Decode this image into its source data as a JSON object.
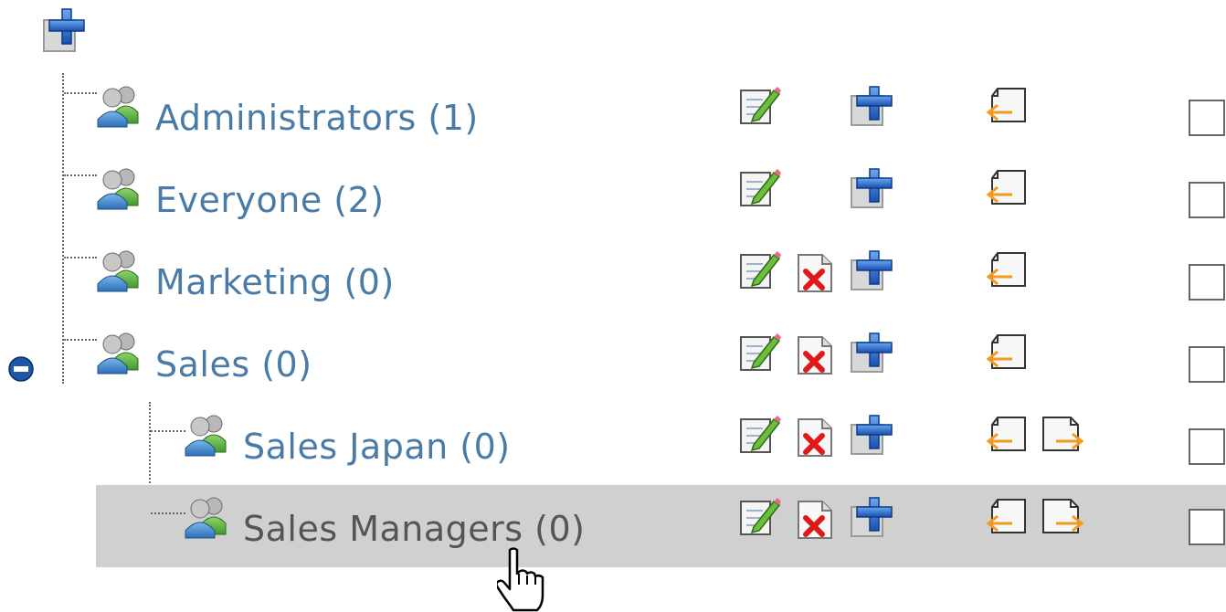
{
  "tree": {
    "groups": [
      {
        "label": "Administrators (1)"
      },
      {
        "label": "Everyone (2)"
      },
      {
        "label": "Marketing (0)"
      },
      {
        "label": "Sales (0)"
      },
      {
        "label": "Sales Japan (0)"
      },
      {
        "label": "Sales Managers (0)"
      }
    ],
    "selected_group": "Sales Managers (0)",
    "expanded_group": "Sales (0)"
  },
  "icons": {
    "root_add": "add-icon",
    "group": "group-icon",
    "edit": "edit-icon",
    "delete": "delete-icon",
    "add": "add-icon",
    "move_left": "move-left-icon",
    "move_right": "move-right-icon",
    "collapse": "collapse-icon",
    "cursor": "hand-cursor-icon"
  },
  "colors": {
    "link": "#4a7ba6",
    "selected_label": "#555555",
    "selected_bg": "#d0d0d0",
    "add_blue": "#1f5fbf",
    "delete_red": "#e01818",
    "arrow_orange": "#f39a1e"
  }
}
